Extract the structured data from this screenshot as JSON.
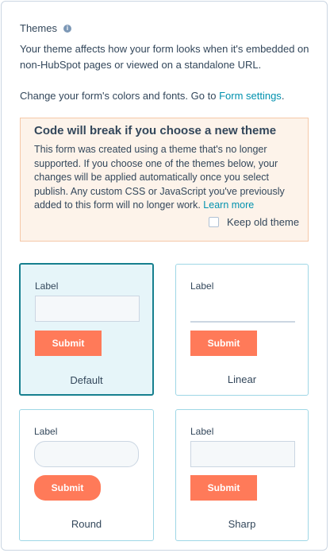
{
  "section": {
    "title": "Themes",
    "info_icon": "info-icon",
    "description": "Your theme affects how your form looks when it's embedded on non-HubSpot pages or viewed on a standalone URL.",
    "change_text": "Change your form's colors and fonts. Go to ",
    "form_settings_link": "Form settings",
    "change_suffix": "."
  },
  "alert": {
    "title": "Code will break if you choose a new theme",
    "body": "This form was created using a theme that's no longer supported. If you choose one of the themes below, your changes will be applied automatically once you select publish. Any custom CSS or JavaScript you've previously added to this form will no longer work. ",
    "learn_more": "Learn more",
    "keep_old_theme": "Keep old theme"
  },
  "themes": [
    {
      "name": "Default",
      "label": "Label",
      "submit": "Submit",
      "selected": true
    },
    {
      "name": "Linear",
      "label": "Label",
      "submit": "Submit",
      "selected": false
    },
    {
      "name": "Round",
      "label": "Label",
      "submit": "Submit",
      "selected": false
    },
    {
      "name": "Sharp",
      "label": "Label",
      "submit": "Submit",
      "selected": false
    }
  ],
  "colors": {
    "accent_button": "#ff7a59",
    "selected_border": "#17808f",
    "link": "#0091ae"
  }
}
